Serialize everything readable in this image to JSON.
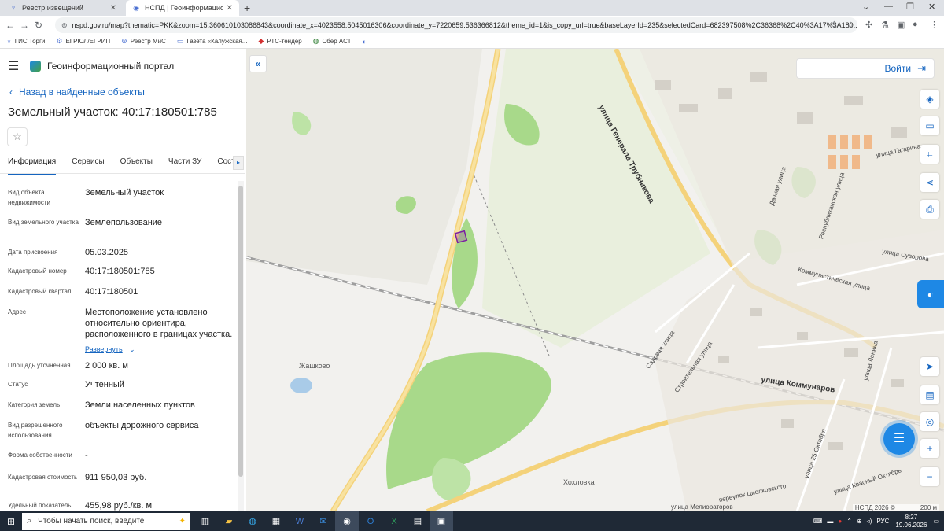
{
  "browser": {
    "tabs": [
      {
        "title": "Реестр извещений",
        "active": false
      },
      {
        "title": "НСПД | Геоинформационный п",
        "active": true
      }
    ],
    "url": "nspd.gov.ru/map?thematic=PKK&zoom=15.360610103086843&coordinate_x=4023558.5045016306&coordinate_y=7220659.536366812&theme_id=1&is_copy_url=true&baseLayerId=235&selectedCard=682397508%2C36368%2C40%3A17%3A180...",
    "bookmarks": [
      "ГИС Торги",
      "ЕГРЮЛ/ЕГРИП",
      "Реестр МиС",
      "Газета «Калужская...",
      "РТС-тендер",
      "Сбер АСТ"
    ]
  },
  "panel": {
    "portal_title": "Геоинформационный портал",
    "back_label": "Назад в найденные объекты",
    "object_title": "Земельный участок: 40:17:180501:785",
    "tabs": [
      "Информация",
      "Сервисы",
      "Объекты",
      "Части ЗУ",
      "Состав"
    ],
    "selected_tab": "Информация",
    "properties": [
      {
        "key": "Вид объекта недвижимости",
        "value": "Земельный участок"
      },
      {
        "key": "Вид земельного участка",
        "value": "Землепользование"
      },
      {
        "key": "Дата присвоения",
        "value": "05.03.2025"
      },
      {
        "key": "Кадастровый номер",
        "value": "40:17:180501:785"
      },
      {
        "key": "Кадастровый квартал",
        "value": "40:17:180501"
      },
      {
        "key": "Адрес",
        "value": "Местоположение установлено относительно ориентира, расположенного в границах участка."
      },
      {
        "key": "Площадь уточненная",
        "value": "2 000 кв. м"
      },
      {
        "key": "Статус",
        "value": "Учтенный"
      },
      {
        "key": "Категория земель",
        "value": "Земли населенных пунктов"
      },
      {
        "key": "Вид разрешенного использования",
        "value": "объекты дорожного сервиса"
      },
      {
        "key": "Форма собственности",
        "value": "-"
      },
      {
        "key": "Кадастровая стоимость",
        "value": "911 950,03 руб."
      },
      {
        "key": "Удельный показатель",
        "value": "455,98 руб./кв. м"
      }
    ],
    "expand_label": "Развернуть"
  },
  "map": {
    "login_label": "Войти",
    "place_labels": [
      "Жашково",
      "Хохловка"
    ],
    "streets": [
      "улица Генерала Трубникова",
      "улица Коммунаров",
      "улица Гагарина",
      "улица Суворова",
      "Коммунистическая улица",
      "Садовая улица",
      "Строительная улица",
      "улица 25 Октября",
      "улица Ленина",
      "улица Красный Октябрь",
      "переулок Циолковского",
      "улица Мелиораторов",
      "Дачная улица",
      "Республиканская улица"
    ],
    "attribution": "НСПД 2026 ©",
    "scale": "200 м"
  },
  "taskbar": {
    "search_placeholder": "Чтобы начать поиск, введите",
    "lang": "РУС",
    "time": "8:27",
    "date": "19.06.2026"
  }
}
